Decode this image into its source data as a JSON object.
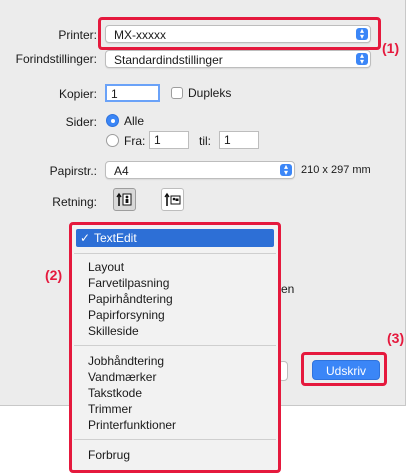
{
  "printer": {
    "label": "Printer:",
    "value": "MX-xxxxx"
  },
  "presets": {
    "label": "Forindstillinger:",
    "value": "Standardindstillinger"
  },
  "copies": {
    "label": "Kopier:",
    "value": "1",
    "duplex_label": "Dupleks"
  },
  "pages": {
    "label": "Sider:",
    "all_label": "Alle",
    "from_label": "Fra:",
    "from_value": "1",
    "to_label": "til:",
    "to_value": "1"
  },
  "paper": {
    "label": "Papirstr.:",
    "value": "A4",
    "size_text": "210 x 297 mm"
  },
  "orientation": {
    "label": "Retning:"
  },
  "partial": {
    "text": "en"
  },
  "menu": {
    "selected": "TextEdit",
    "group1": [
      "Layout",
      "Farvetilpasning",
      "Papirhåndtering",
      "Papirforsyning",
      "Skilleside"
    ],
    "group2": [
      "Jobhåndtering",
      "Vandmærker",
      "Takstkode",
      "Trimmer",
      "Printerfunktioner"
    ],
    "group3": [
      "Forbrug"
    ]
  },
  "buttons": {
    "print": "Udskriv"
  },
  "markers": {
    "m1": "(1)",
    "m2": "(2)",
    "m3": "(3)"
  },
  "colors": {
    "accent": "#3b86f7",
    "highlight": "#e5193d",
    "menu_selected_bg": "#2d6fd6"
  }
}
